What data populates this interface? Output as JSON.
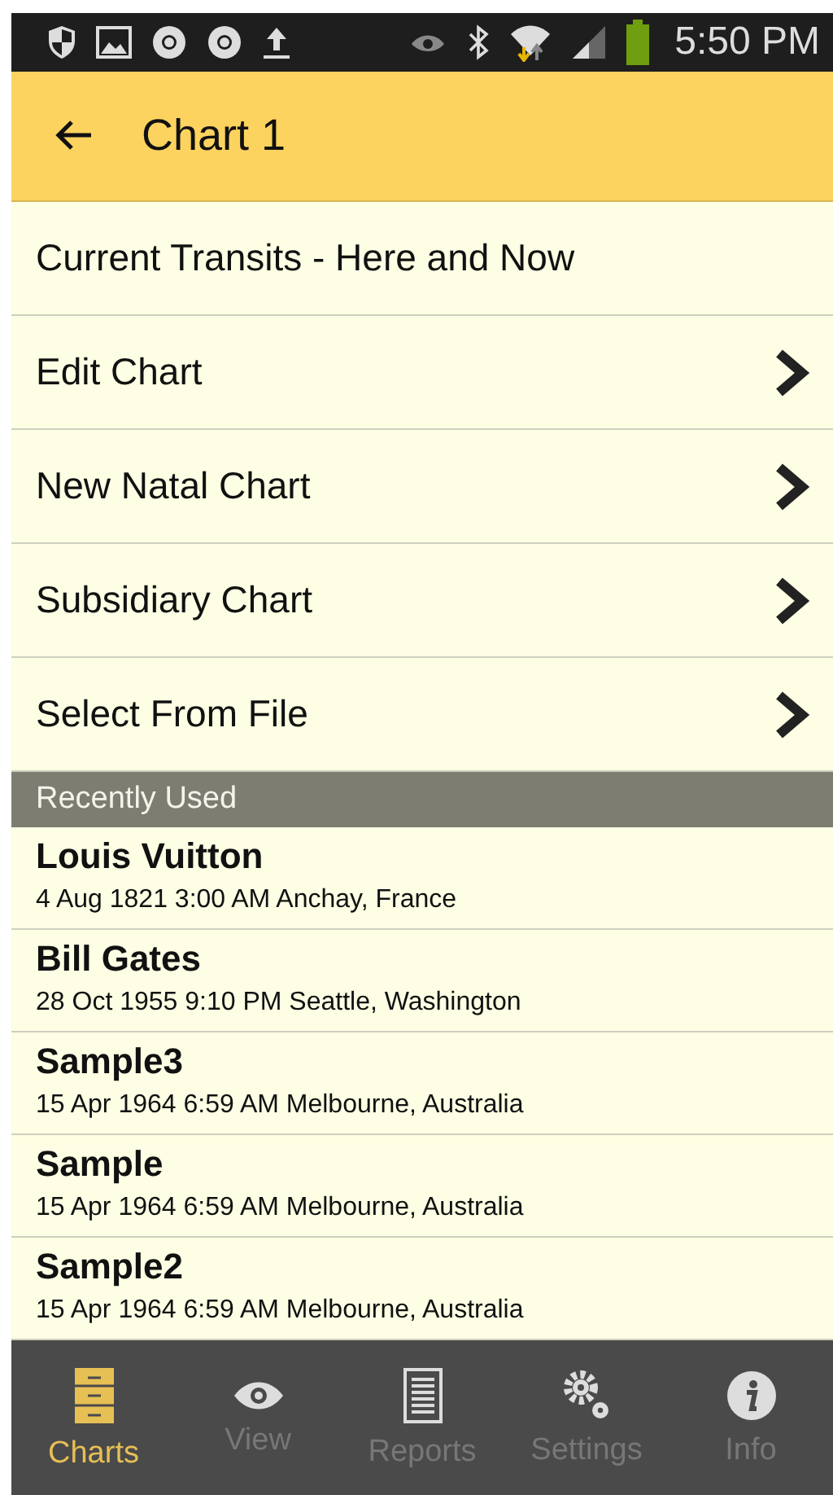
{
  "status_bar": {
    "time": "5:50 PM"
  },
  "app_bar": {
    "title": "Chart 1"
  },
  "menu": [
    {
      "label": "Current Transits - Here and Now",
      "chevron": false
    },
    {
      "label": "Edit Chart",
      "chevron": true
    },
    {
      "label": "New Natal Chart",
      "chevron": true
    },
    {
      "label": "Subsidiary Chart",
      "chevron": true
    },
    {
      "label": "Select From File",
      "chevron": true
    }
  ],
  "recent": {
    "header": "Recently Used",
    "items": [
      {
        "name": "Louis Vuitton",
        "details": "4 Aug 1821 3:00 AM Anchay, France"
      },
      {
        "name": "Bill Gates",
        "details": "28 Oct 1955 9:10 PM Seattle, Washington"
      },
      {
        "name": "Sample3",
        "details": "15 Apr 1964 6:59 AM Melbourne, Australia"
      },
      {
        "name": "Sample",
        "details": "15 Apr 1964 6:59 AM Melbourne, Australia"
      },
      {
        "name": "Sample2",
        "details": "15 Apr 1964 6:59 AM Melbourne, Australia"
      }
    ]
  },
  "tabs": [
    {
      "label": "Charts",
      "kind": "cabinet",
      "selected": true
    },
    {
      "label": "View",
      "kind": "eye",
      "selected": false
    },
    {
      "label": "Reports",
      "kind": "document",
      "selected": false
    },
    {
      "label": "Settings",
      "kind": "gears",
      "selected": false
    },
    {
      "label": "Info",
      "kind": "info",
      "selected": false
    }
  ]
}
